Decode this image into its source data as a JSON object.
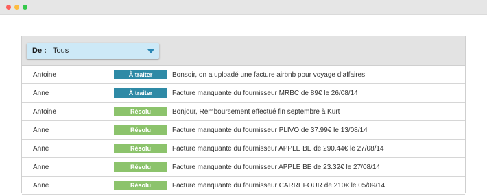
{
  "window": {
    "controls": [
      {
        "name": "close",
        "color": "#fc605c"
      },
      {
        "name": "minimize",
        "color": "#fdbc40"
      },
      {
        "name": "maximize",
        "color": "#34c84a"
      }
    ]
  },
  "filter": {
    "label": "De :",
    "value": "Tous",
    "icon": "chevron-down-icon"
  },
  "status_colors": {
    "todo": "#2e8aa6",
    "done": "#8cc36c"
  },
  "rows": [
    {
      "from": "Antoine",
      "status": "À traiter",
      "status_kind": "todo",
      "subject": "Bonsoir, on a uploadé une facture airbnb pour voyage d’affaires"
    },
    {
      "from": "Anne",
      "status": "À traiter",
      "status_kind": "todo",
      "subject": "Facture manquante du fournisseur MRBC de 89€ le 26/08/14"
    },
    {
      "from": "Antoine",
      "status": "Résolu",
      "status_kind": "done",
      "subject": "Bonjour, Remboursement effectué fin septembre à Kurt"
    },
    {
      "from": "Anne",
      "status": "Résolu",
      "status_kind": "done",
      "subject": "Facture manquante du fournisseur PLIVO de 37.99€ le 13/08/14"
    },
    {
      "from": "Anne",
      "status": "Résolu",
      "status_kind": "done",
      "subject": "Facture manquante du fournisseur APPLE BE de 290.44€ le 27/08/14"
    },
    {
      "from": "Anne",
      "status": "Résolu",
      "status_kind": "done",
      "subject": "Facture manquante du fournisseur APPLE BE de 23.32€ le 27/08/14"
    },
    {
      "from": "Anne",
      "status": "Résolu",
      "status_kind": "done",
      "subject": "Facture manquante du fournisseur CARREFOUR de 210€ le 05/09/14"
    }
  ]
}
